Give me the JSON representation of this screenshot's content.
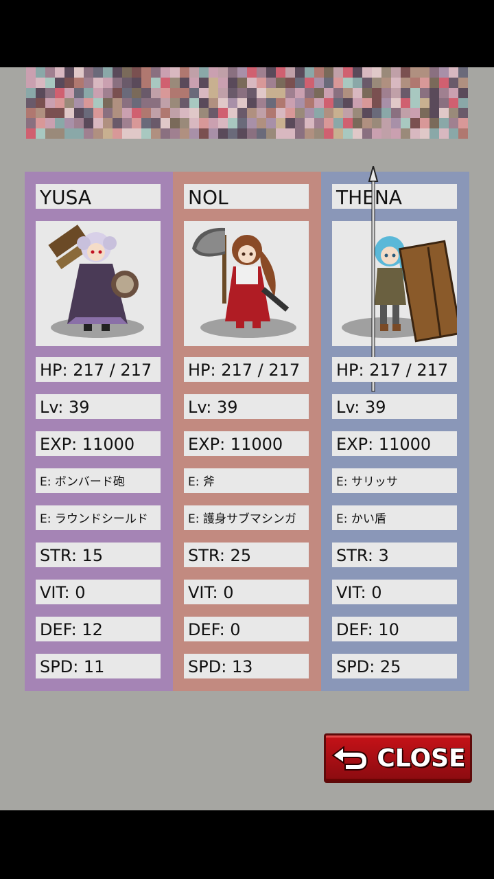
{
  "colors": {
    "background": "#a6a6a2",
    "panel_yusa": "#a584b5",
    "panel_nol": "#c28a80",
    "panel_thena": "#8a97b8",
    "cell": "#e8e8e8",
    "close_button": "#b40f14"
  },
  "characters": [
    {
      "name": "YUSA",
      "hp": "HP: 217 / 217",
      "lv": "Lv: 39",
      "exp": "EXP: 11000",
      "equip1": "E: ボンバード砲",
      "equip2": "E: ラウンドシールド",
      "str": "STR: 15",
      "vit": "VIT: 0",
      "def": "DEF: 12",
      "spd": "SPD: 11",
      "portrait_icon": "gunner-girl-sprite"
    },
    {
      "name": "NOL",
      "hp": "HP: 217 / 217",
      "lv": "Lv: 39",
      "exp": "EXP: 11000",
      "equip1": "E: 斧",
      "equip2": "E: 護身サブマシンガ",
      "str": "STR: 25",
      "vit": "VIT: 0",
      "def": "DEF: 0",
      "spd": "SPD: 13",
      "portrait_icon": "axe-girl-sprite"
    },
    {
      "name": "THENA",
      "hp": "HP: 217 / 217",
      "lv": "Lv: 39",
      "exp": "EXP: 11000",
      "equip1": "E: サリッサ",
      "equip2": "E: かい盾",
      "str": "STR: 3",
      "vit": "VIT: 0",
      "def": "DEF: 10",
      "spd": "SPD: 25",
      "portrait_icon": "spear-girl-sprite"
    }
  ],
  "close_button": {
    "label": "CLOSE",
    "icon": "return-arrow-icon"
  }
}
